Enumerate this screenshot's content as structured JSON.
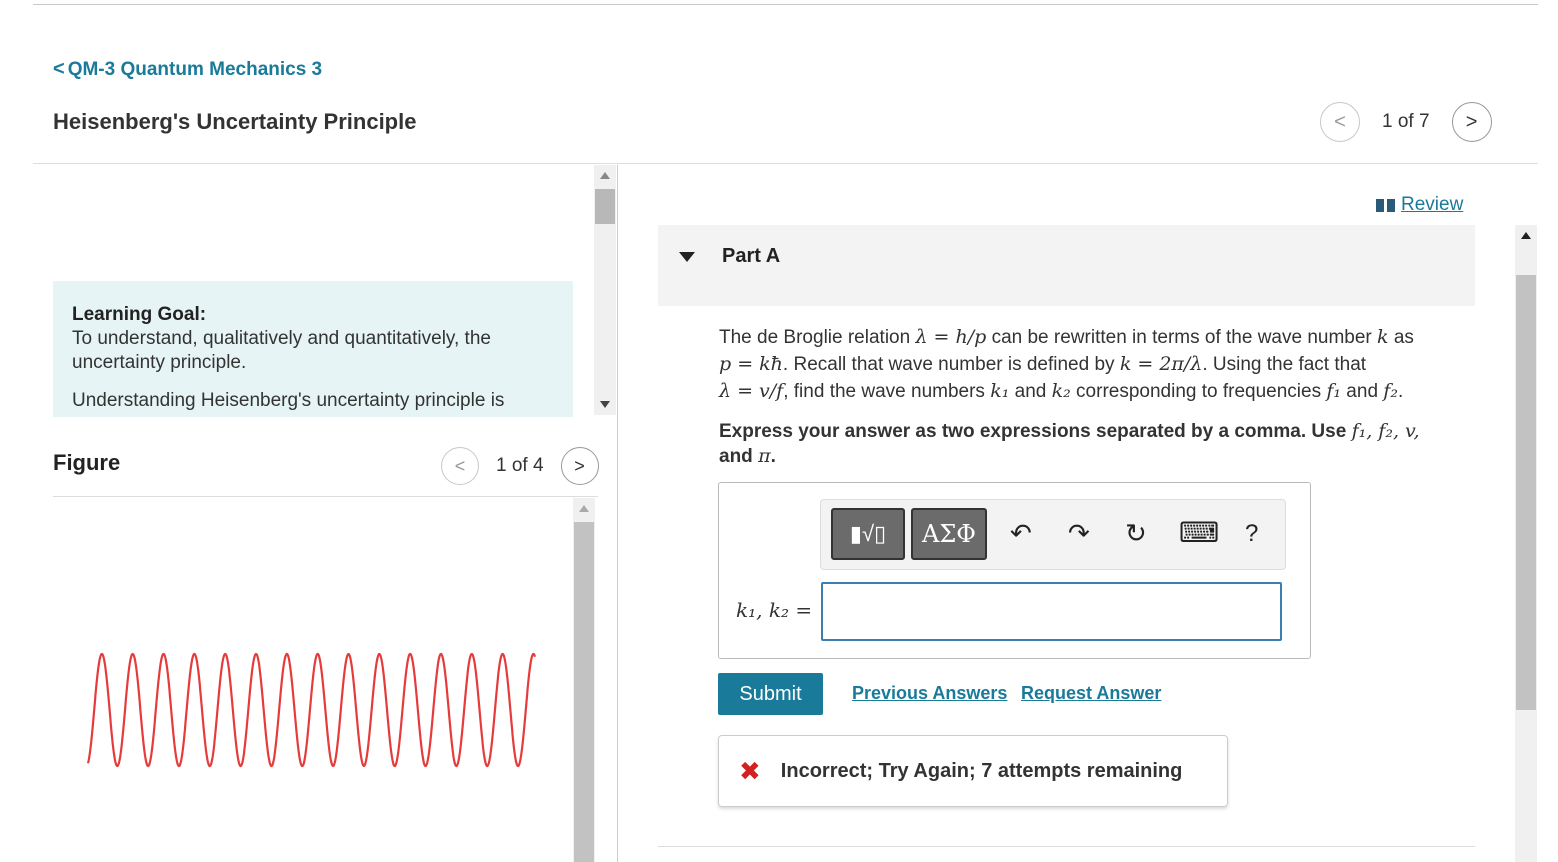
{
  "breadcrumb": {
    "chevron": "<",
    "label": "QM-3 Quantum Mechanics 3"
  },
  "page_title": "Heisenberg's Uncertainty Principle",
  "pager": {
    "prev_icon": "<",
    "label": "1 of 7",
    "next_icon": ">"
  },
  "learning_goal": {
    "heading": "Learning Goal:",
    "text": "To understand, qualitatively and quantitatively, the uncertainty principle.",
    "more": "Understanding Heisenberg's uncertainty principle is"
  },
  "figure": {
    "label": "Figure",
    "pager": {
      "prev_icon": "<",
      "label": "1 of 4",
      "next_icon": ">"
    },
    "wave_color": "#e63b3b"
  },
  "review_link": "Review",
  "part": {
    "label": "Part A"
  },
  "question": {
    "t1": "The de Broglie relation ",
    "m1": "λ = h/p",
    "t2": " can be rewritten in terms of the wave number ",
    "m2": "k",
    "t3": " as ",
    "m3": "p = kħ",
    "t4": ". Recall that wave number is defined by ",
    "m4": "k = 2π/λ",
    "t5": ". Using the fact that ",
    "m5": "λ = v/f",
    "t6": ", find the wave numbers ",
    "m6": "k₁",
    "t7": " and ",
    "m7": "k₂",
    "t8": " corresponding to frequencies ",
    "m8": "f₁",
    "t9": " and ",
    "m9": "f₂",
    "t10": "."
  },
  "instruction": {
    "t1": "Express your answer as two expressions separated by a comma. Use ",
    "m1": "f₁, f₂, v,",
    "t2": " and ",
    "m2": "π",
    "t3": "."
  },
  "toolbar": {
    "template_label": "▮√▯",
    "greek_label": "ΑΣΦ",
    "undo_icon": "↶",
    "redo_icon": "↷",
    "reset_icon": "↻",
    "keyboard_icon": "⌨",
    "help_label": "?"
  },
  "answer": {
    "label": "k₁, k₂ =",
    "value": ""
  },
  "buttons": {
    "submit": "Submit",
    "previous_answers": "Previous Answers",
    "request_answer": "Request Answer"
  },
  "feedback": {
    "icon": "✖",
    "message": "Incorrect; Try Again; 7 attempts remaining",
    "icon_color": "#d42020"
  },
  "accent_color": "#1a7a9a"
}
